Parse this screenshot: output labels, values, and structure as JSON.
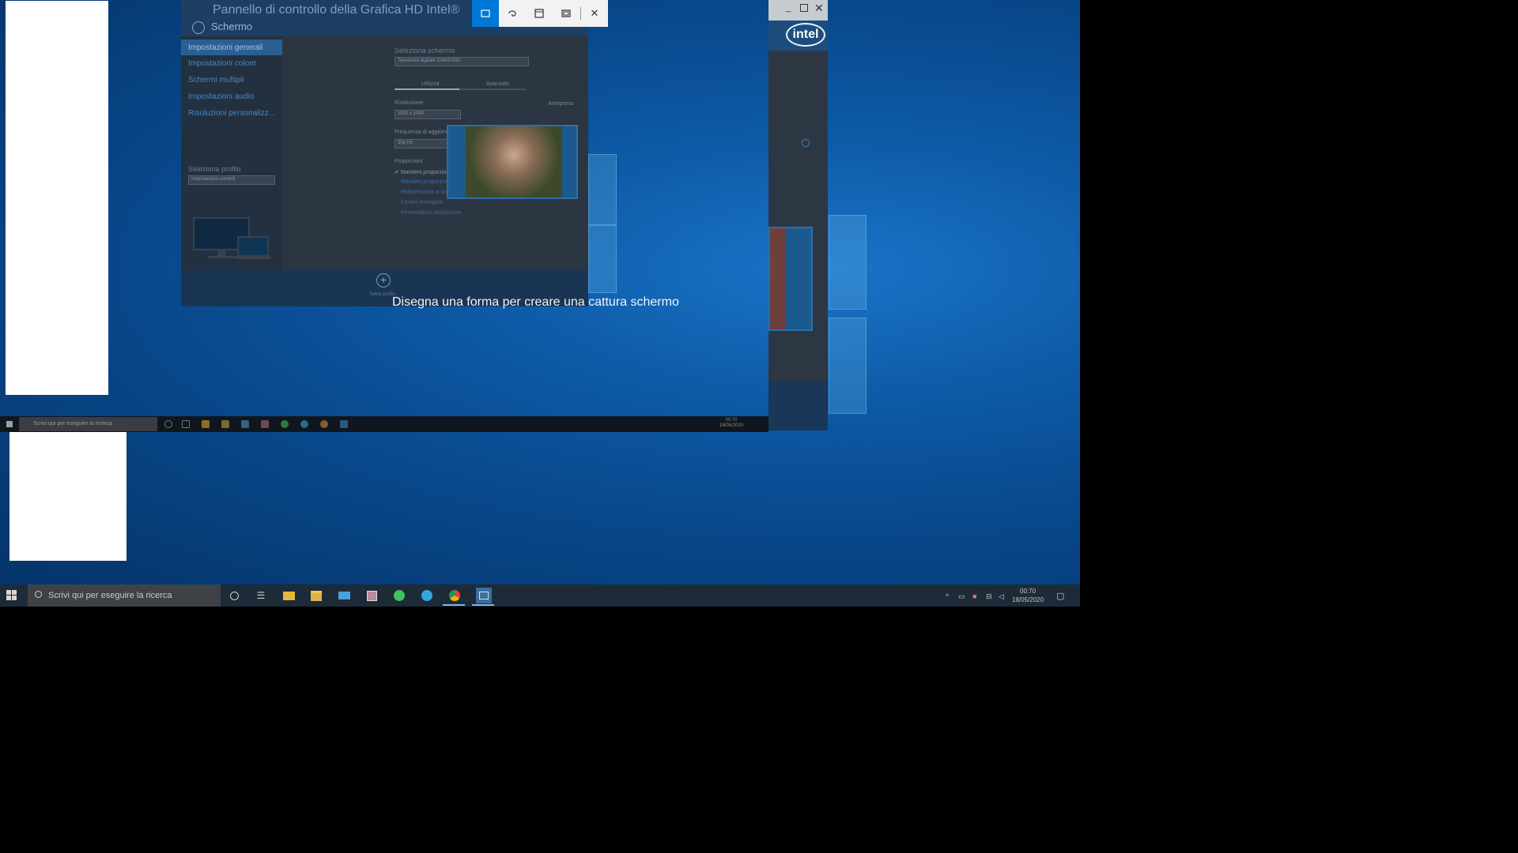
{
  "intel_window": {
    "title": "Pannello di controllo della Grafica HD Intel®",
    "section": "Schermo",
    "nav": [
      "Impostazioni generali",
      "Impostazioni colore",
      "Schermi multipli",
      "Impostazioni audio",
      "Risoluzioni personalizz..."
    ],
    "select_display_label": "Seleziona schermo",
    "select_display_value": "Televisore digitale SAMSUNG",
    "tabs": [
      "Utilizza",
      "Avanzate"
    ],
    "resolution_label": "Risoluzione",
    "resolution_value": "1920 x 1080",
    "refresh_label": "Frequenza di aggiornamento",
    "refresh_value": "30p Hz",
    "scale_label": "Proporzioni",
    "scale_checkbox_label": "Mantieni proporzioni schermo",
    "scale_options": [
      "Mantieni proporzioni",
      "Ridimensiona a schermo intero",
      "Centra immagine",
      "Personalizza proporzioni"
    ],
    "preview_label": "Anteprima",
    "profile_label": "Seleziona profilo",
    "profile_value": "Impostazioni correnti",
    "save_label": "Salva profilo"
  },
  "intel_logo_text": "intel",
  "snip": {
    "hint": "Disegna una forma per creare una cattura schermo",
    "buttons": [
      "rectangle-snip",
      "freeform-snip",
      "window-snip",
      "fullscreen-snip",
      "close"
    ]
  },
  "mini_taskbar": {
    "search_placeholder": "Scrivi qui per eseguire la ricerca",
    "time": "00:70",
    "date": "18/05/2020"
  },
  "taskbar": {
    "search_placeholder": "Scrivi qui per eseguire la ricerca",
    "time": "00:70",
    "date": "18/05/2020"
  }
}
